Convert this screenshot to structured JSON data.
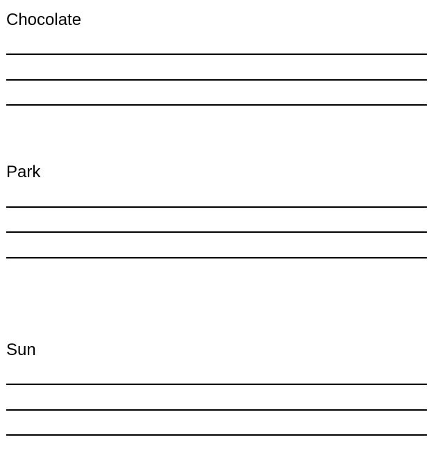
{
  "sections": [
    {
      "word": "Chocolate",
      "line_count": 3
    },
    {
      "word": "Park",
      "line_count": 3
    },
    {
      "word": "Sun",
      "line_count": 3
    }
  ]
}
